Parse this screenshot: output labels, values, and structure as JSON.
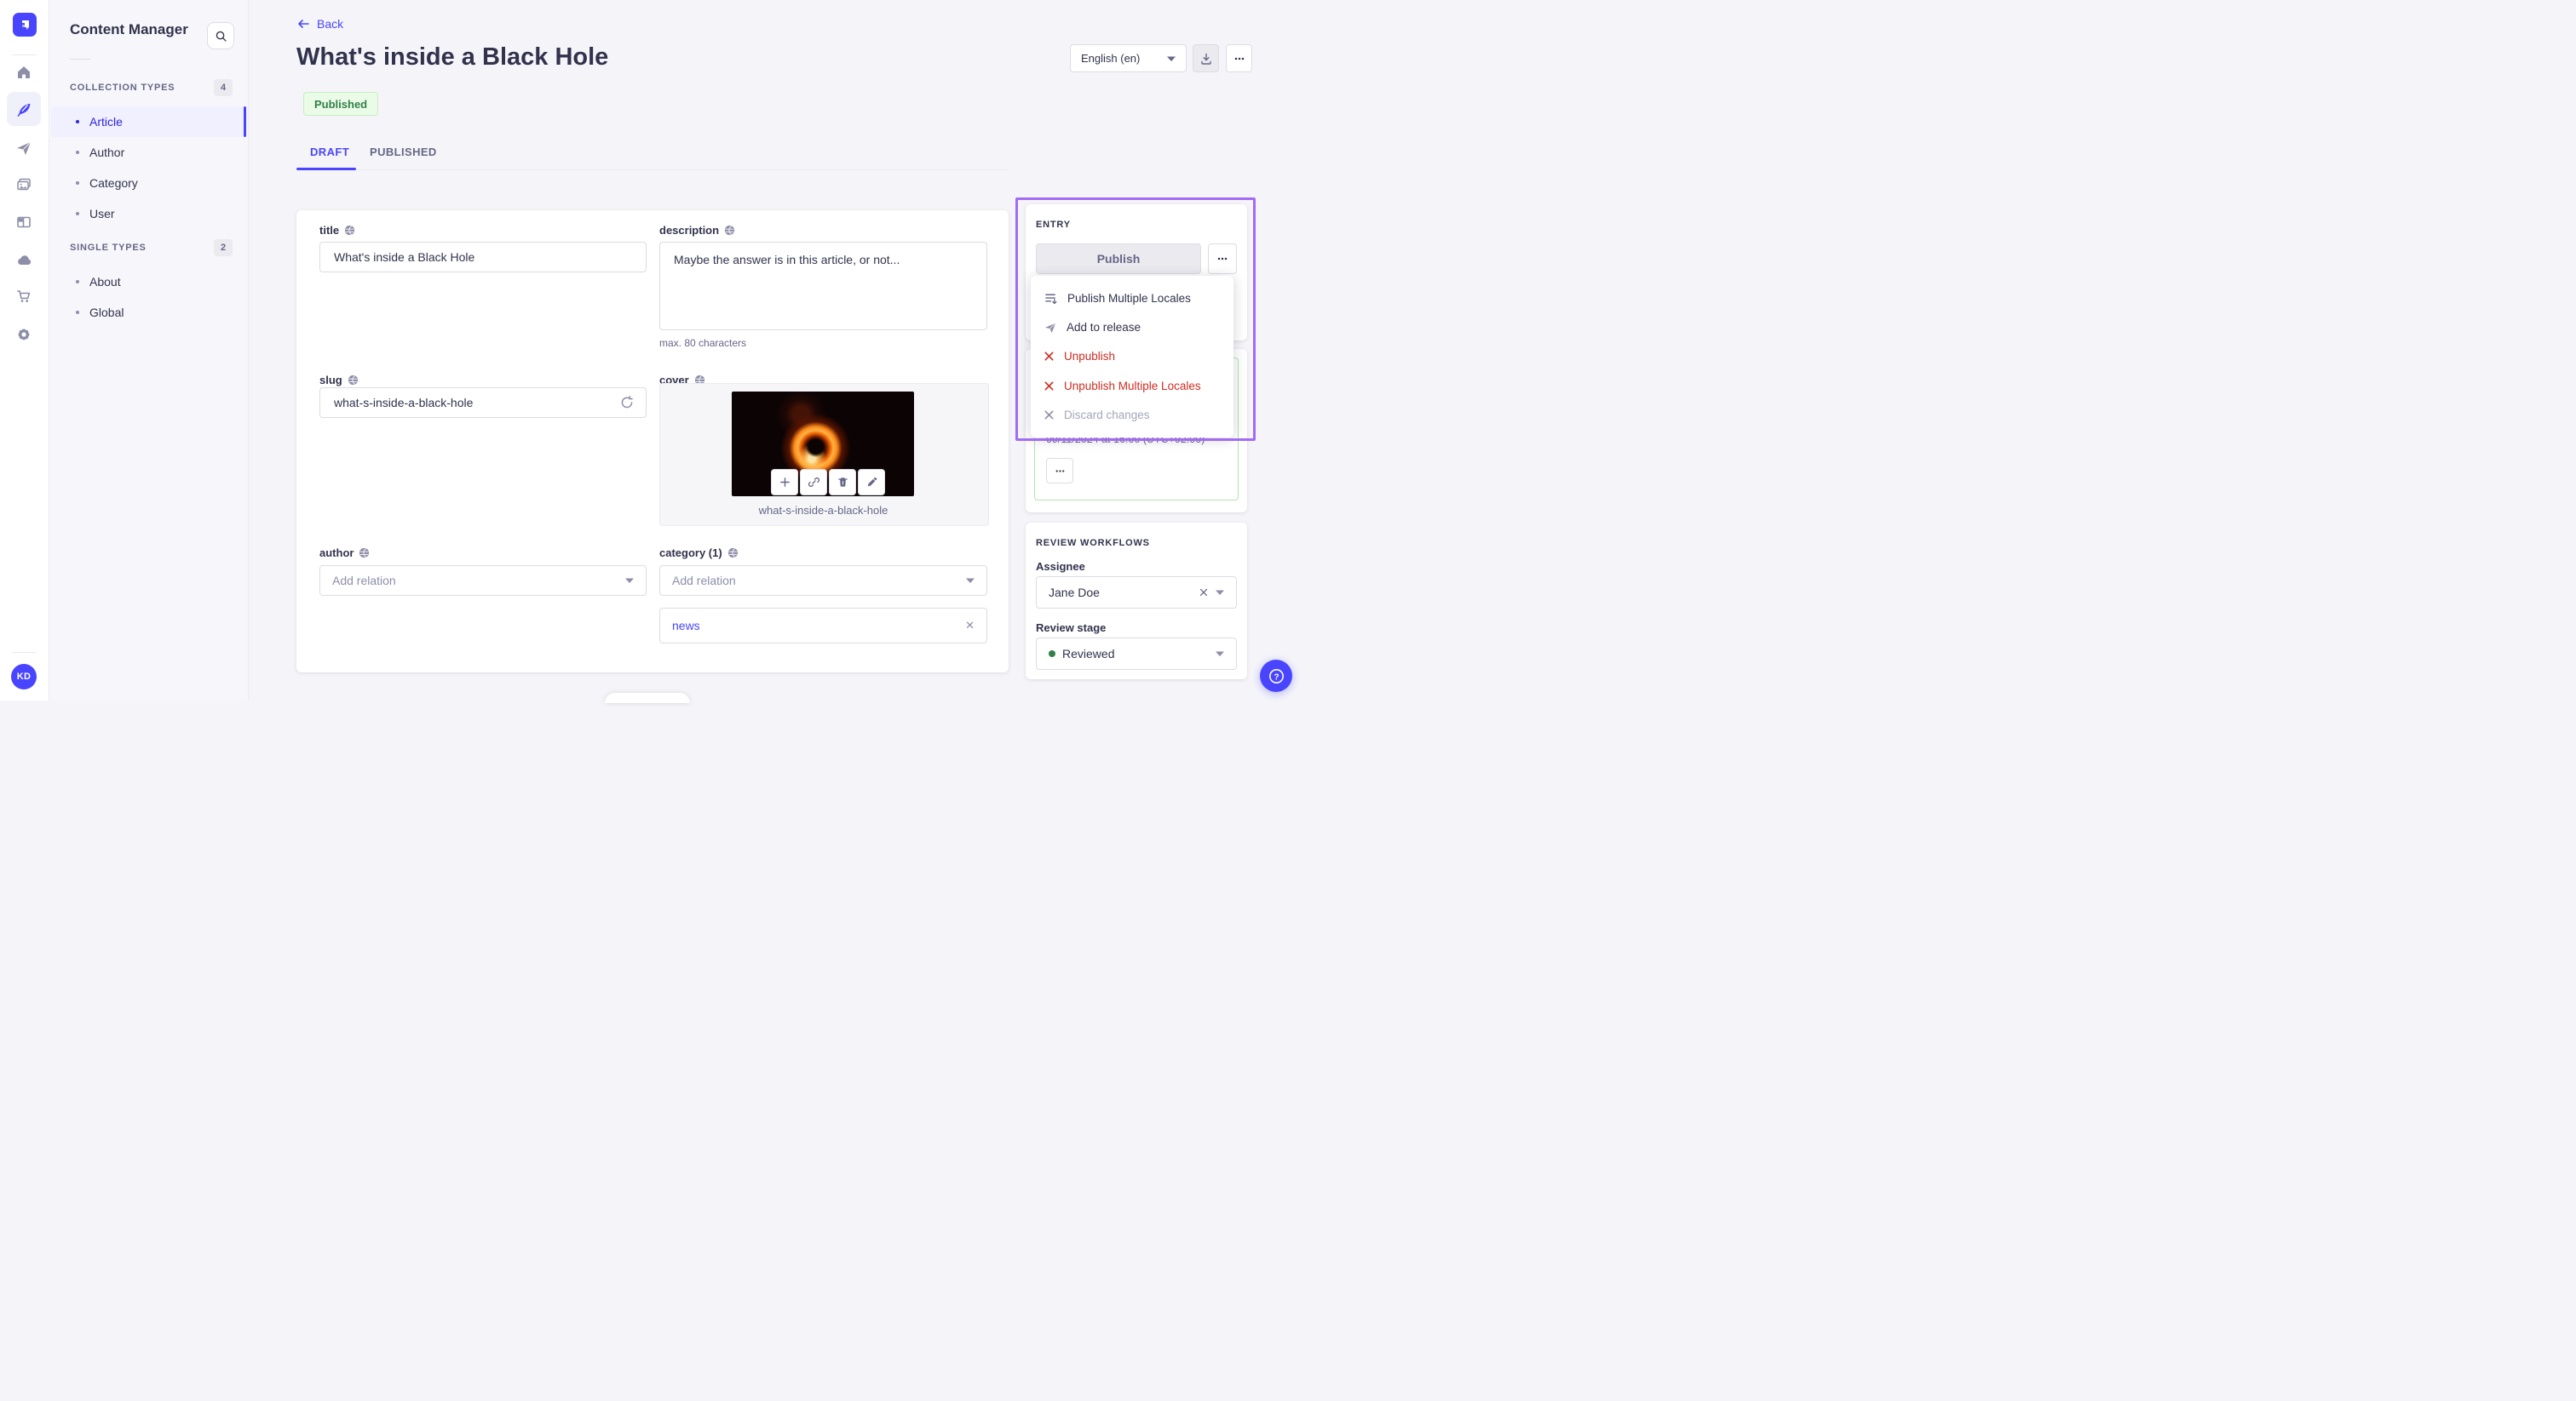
{
  "rail": {
    "avatar_initials": "KD",
    "icons": [
      "home",
      "content-manager",
      "releases",
      "media-library",
      "content-type-builder",
      "deployments",
      "marketplace",
      "settings"
    ]
  },
  "subnav": {
    "title": "Content Manager",
    "sections": [
      {
        "label": "COLLECTION TYPES",
        "count": "4",
        "items": [
          "Article",
          "Author",
          "Category",
          "User"
        ]
      },
      {
        "label": "SINGLE TYPES",
        "count": "2",
        "items": [
          "About",
          "Global"
        ]
      }
    ]
  },
  "header": {
    "back_label": "Back",
    "title": "What's inside a Black Hole",
    "status_badge": "Published",
    "locale_value": "English (en)"
  },
  "tabs": {
    "draft": "DRAFT",
    "published": "PUBLISHED"
  },
  "form": {
    "title": {
      "label": "title",
      "value": "What's inside a Black Hole"
    },
    "description": {
      "label": "description",
      "value": "Maybe the answer is in this article, or not...",
      "hint": "max. 80 characters"
    },
    "slug": {
      "label": "slug",
      "value": "what-s-inside-a-black-hole"
    },
    "cover": {
      "label": "cover",
      "caption": "what-s-inside-a-black-hole"
    },
    "author": {
      "label": "author",
      "placeholder": "Add relation"
    },
    "category": {
      "label": "category (1)",
      "placeholder": "Add relation",
      "relation": "news"
    }
  },
  "entry": {
    "heading": "ENTRY",
    "publish_label": "Publish",
    "menu": [
      {
        "label": "Publish Multiple Locales"
      },
      {
        "label": "Add to release"
      },
      {
        "label": "Unpublish"
      },
      {
        "label": "Unpublish Multiple Locales"
      },
      {
        "label": "Discard changes"
      }
    ],
    "scheduled_date": "09/11/2024 at 16:00 (UTC+02:00)"
  },
  "review": {
    "heading": "REVIEW WORKFLOWS",
    "assignee_label": "Assignee",
    "assignee_value": "Jane Doe",
    "stage_label": "Review stage",
    "stage_value": "Reviewed"
  },
  "colors": {
    "primary": "#4945ff",
    "danger": "#d02b20",
    "success_text": "#328048",
    "success_bg": "#eafbe7",
    "highlight_outline": "#a26bf5"
  }
}
